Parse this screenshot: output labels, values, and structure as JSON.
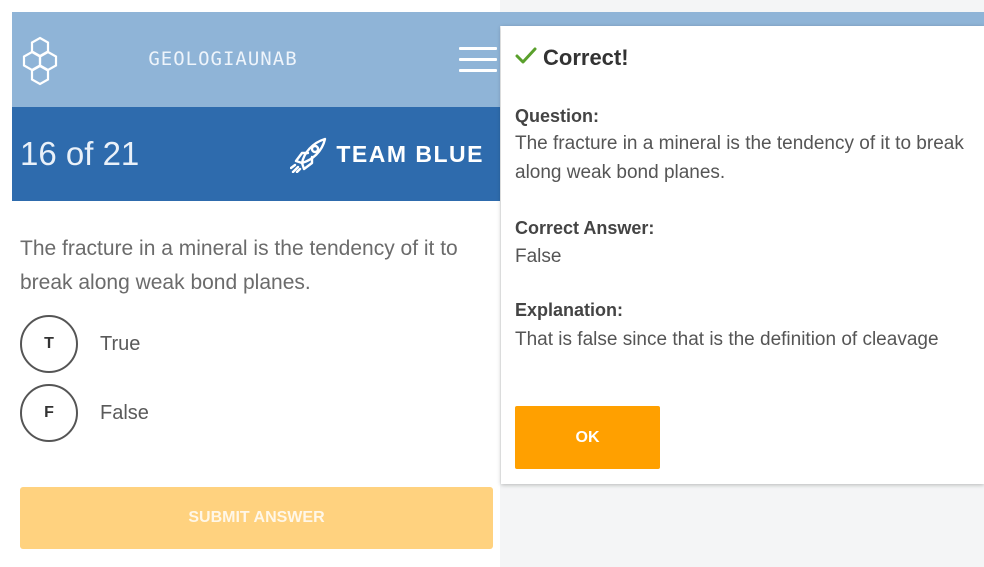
{
  "app": {
    "brand": "GEOLOGIAUNAB",
    "logo_icon": "hexagon-cluster-icon",
    "menu_icon": "hamburger-menu-icon"
  },
  "quiz": {
    "progress": "16 of 21",
    "team_icon": "rocket-icon",
    "team": "TEAM BLUE",
    "question": "The fracture in a mineral is the tendency of it to break along weak bond planes.",
    "options": [
      {
        "letter": "T",
        "label": "True"
      },
      {
        "letter": "F",
        "label": "False"
      }
    ],
    "submit_label": "SUBMIT ANSWER"
  },
  "result_modal": {
    "status_icon": "checkmark-icon",
    "title": "Correct!",
    "question_label": "Question:",
    "question_text": "The fracture in a mineral is the tendency of it to break along weak bond planes.",
    "answer_label": "Correct Answer:",
    "answer_text": "False",
    "explanation_label": "Explanation:",
    "explanation_text": "That is false since that is the definition of cleavage",
    "ok_label": "OK"
  },
  "colors": {
    "header_light_blue": "#8fb4d7",
    "header_dark_blue": "#2e6bad",
    "submit_disabled": "#ffd27f",
    "ok_button": "#ffa000",
    "check_green": "#5aa02c"
  }
}
